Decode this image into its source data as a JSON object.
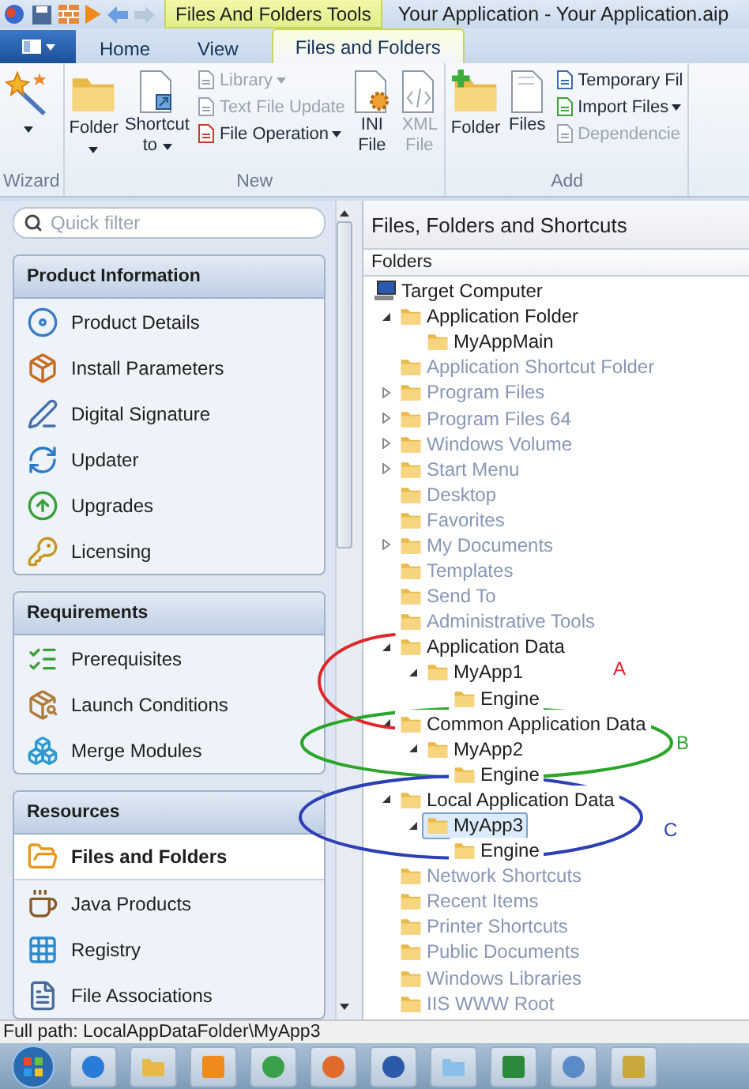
{
  "title_bar": {
    "context_tab": "Files And Folders Tools",
    "title": "Your Application - Your Application.aip"
  },
  "tabs": [
    {
      "label": "Home",
      "selected": false
    },
    {
      "label": "View",
      "selected": false
    },
    {
      "label": "Files and Folders",
      "selected": true
    }
  ],
  "ribbon": [
    {
      "name": "Wizard",
      "buttons": [
        {
          "kind": "large",
          "caret": true,
          "disabled": false
        }
      ]
    },
    {
      "name": "New",
      "buttons": [
        {
          "kind": "large",
          "label": "Folder",
          "caret": true,
          "disabled": false
        },
        {
          "kind": "large",
          "label": "Shortcut to",
          "caret": true,
          "disabled": false
        },
        {
          "kind": "stack",
          "items": [
            {
              "label": "Library",
              "caret": true,
              "disabled": true
            },
            {
              "label": "Text File Update",
              "caret": false,
              "disabled": true
            },
            {
              "label": "File Operation",
              "caret": true,
              "disabled": false
            }
          ]
        },
        {
          "kind": "large",
          "label": "INI File",
          "caret": false,
          "disabled": false
        },
        {
          "kind": "large",
          "label": "XML File",
          "caret": false,
          "disabled": true
        }
      ]
    },
    {
      "name": "Add",
      "buttons": [
        {
          "kind": "large",
          "label": "Folder",
          "caret": false,
          "disabled": false
        },
        {
          "kind": "large",
          "label": "Files",
          "caret": false,
          "disabled": false
        },
        {
          "kind": "stack",
          "items": [
            {
              "label": "Temporary Fil",
              "caret": false,
              "disabled": false
            },
            {
              "label": "Import Files",
              "caret": true,
              "disabled": false
            },
            {
              "label": "Dependencie",
              "caret": false,
              "disabled": true
            }
          ]
        }
      ]
    }
  ],
  "quick_filter": {
    "placeholder": "Quick filter"
  },
  "sidebar": [
    {
      "title": "Product Information",
      "items": [
        {
          "label": "Product Details",
          "selected": false
        },
        {
          "label": "Install Parameters",
          "selected": false
        },
        {
          "label": "Digital Signature",
          "selected": false
        },
        {
          "label": "Updater",
          "selected": false
        },
        {
          "label": "Upgrades",
          "selected": false
        },
        {
          "label": "Licensing",
          "selected": false
        }
      ]
    },
    {
      "title": "Requirements",
      "items": [
        {
          "label": "Prerequisites",
          "selected": false
        },
        {
          "label": "Launch Conditions",
          "selected": false
        },
        {
          "label": "Merge Modules",
          "selected": false
        }
      ]
    },
    {
      "title": "Resources",
      "items": [
        {
          "label": "Files and Folders",
          "selected": true
        },
        {
          "label": "Java Products",
          "selected": false
        },
        {
          "label": "Registry",
          "selected": false
        },
        {
          "label": "File Associations",
          "selected": false
        }
      ]
    }
  ],
  "panel": {
    "title": "Files, Folders and Shortcuts",
    "column": "Folders"
  },
  "tree": [
    {
      "label": "Target Computer",
      "kind": "computer",
      "disabled": false,
      "selected": false,
      "children": [
        {
          "label": "Application Folder",
          "kind": "folder",
          "expanded": true,
          "disabled": false,
          "selected": false,
          "children": [
            {
              "label": "MyAppMain",
              "kind": "folder",
              "disabled": false,
              "selected": false
            }
          ]
        },
        {
          "label": "Application Shortcut Folder",
          "kind": "folder",
          "disabled": true,
          "selected": false
        },
        {
          "label": "Program Files",
          "kind": "folder",
          "expanded": false,
          "disabled": true,
          "selected": false
        },
        {
          "label": "Program Files 64",
          "kind": "folder",
          "expanded": false,
          "disabled": true,
          "selected": false
        },
        {
          "label": "Windows Volume",
          "kind": "folder",
          "expanded": false,
          "disabled": true,
          "selected": false
        },
        {
          "label": "Start Menu",
          "kind": "folder",
          "expanded": false,
          "disabled": true,
          "selected": false
        },
        {
          "label": "Desktop",
          "kind": "folder",
          "disabled": true,
          "selected": false
        },
        {
          "label": "Favorites",
          "kind": "folder",
          "disabled": true,
          "selected": false
        },
        {
          "label": "My Documents",
          "kind": "folder",
          "expanded": false,
          "disabled": true,
          "selected": false
        },
        {
          "label": "Templates",
          "kind": "folder",
          "disabled": true,
          "selected": false
        },
        {
          "label": "Send To",
          "kind": "folder",
          "disabled": true,
          "selected": false
        },
        {
          "label": "Administrative Tools",
          "kind": "folder",
          "disabled": true,
          "selected": false
        },
        {
          "label": "Application Data",
          "kind": "folder",
          "expanded": true,
          "disabled": false,
          "selected": false,
          "children": [
            {
              "label": "MyApp1",
              "kind": "folder",
              "expanded": true,
              "disabled": false,
              "selected": false,
              "children": [
                {
                  "label": "Engine",
                  "kind": "folder",
                  "disabled": false,
                  "selected": false
                }
              ]
            }
          ]
        },
        {
          "label": "Common Application Data",
          "kind": "folder",
          "expanded": true,
          "disabled": false,
          "selected": false,
          "children": [
            {
              "label": "MyApp2",
              "kind": "folder",
              "expanded": true,
              "disabled": false,
              "selected": false,
              "children": [
                {
                  "label": "Engine",
                  "kind": "folder",
                  "disabled": false,
                  "selected": false
                }
              ]
            }
          ]
        },
        {
          "label": "Local Application Data",
          "kind": "folder",
          "expanded": true,
          "disabled": false,
          "selected": false,
          "children": [
            {
              "label": "MyApp3",
              "kind": "folder",
              "expanded": true,
              "disabled": false,
              "selected": true,
              "children": [
                {
                  "label": "Engine",
                  "kind": "folder",
                  "disabled": false,
                  "selected": false
                }
              ]
            }
          ]
        },
        {
          "label": "Network Shortcuts",
          "kind": "folder",
          "disabled": true,
          "selected": false
        },
        {
          "label": "Recent Items",
          "kind": "folder",
          "disabled": true,
          "selected": false
        },
        {
          "label": "Printer Shortcuts",
          "kind": "folder",
          "disabled": true,
          "selected": false
        },
        {
          "label": "Public Documents",
          "kind": "folder",
          "disabled": true,
          "selected": false
        },
        {
          "label": "Windows Libraries",
          "kind": "folder",
          "disabled": true,
          "selected": false
        },
        {
          "label": "IIS WWW Root",
          "kind": "folder",
          "disabled": true,
          "selected": false
        }
      ]
    }
  ],
  "annotations": [
    {
      "label": "A",
      "color": "#e0282c"
    },
    {
      "label": "B",
      "color": "#2aa52a"
    },
    {
      "label": "C",
      "color": "#2d3fb5"
    }
  ],
  "status_bar": {
    "text": "Full path: LocalAppDataFolder\\MyApp3"
  }
}
